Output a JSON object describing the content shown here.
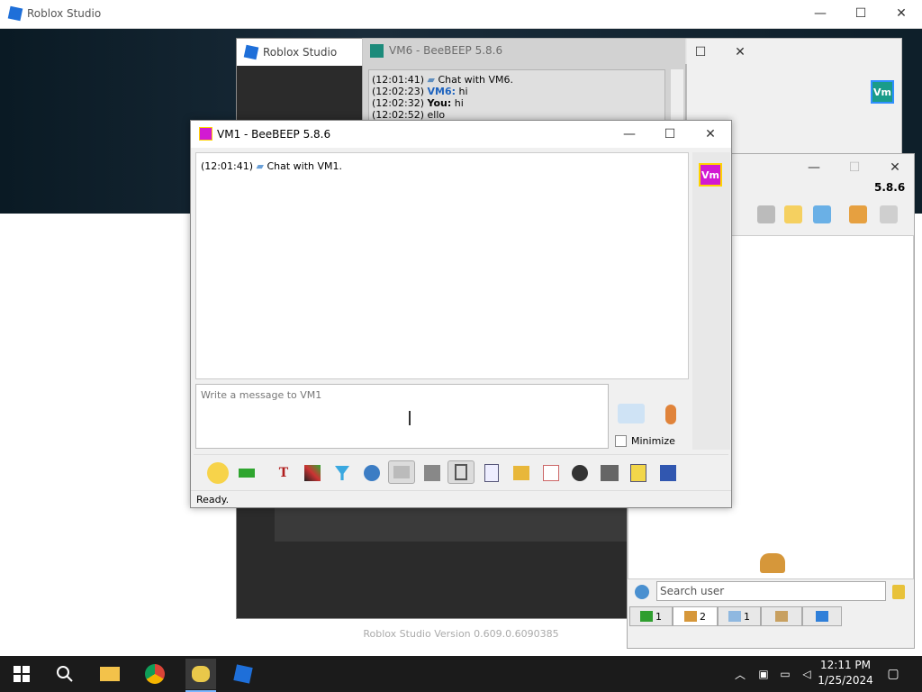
{
  "background_window": {
    "title": "Roblox Studio",
    "colors": {
      "banner": "#0e1f2a"
    }
  },
  "roblox_studio_2": {
    "title": "Roblox Studio",
    "version_text": "Roblox Studio Version 0.609.0.6090385"
  },
  "vm6_window": {
    "title": "VM6 - BeeBEEP 5.8.6",
    "messages": [
      {
        "time": "(12:01:41)",
        "sender": "",
        "text": "Chat with VM6."
      },
      {
        "time": "(12:02:23)",
        "sender": "VM6:",
        "text": "hi"
      },
      {
        "time": "(12:02:32)",
        "sender": "You:",
        "text": "hi"
      },
      {
        "time": "(12:02:52)",
        "sender": "",
        "text": "ello"
      }
    ],
    "badge_text": "Vm"
  },
  "contacts_window": {
    "version": "5.8.6",
    "search_placeholder": "Search user",
    "tabs": [
      {
        "icon": "computer-icon",
        "count": "1"
      },
      {
        "icon": "users-icon",
        "count": "2"
      },
      {
        "icon": "chat-icon",
        "count": "1"
      },
      {
        "icon": "group-icon",
        "count": ""
      },
      {
        "icon": "share-icon",
        "count": ""
      }
    ]
  },
  "vm1_window": {
    "title": "VM1 - BeeBEEP 5.8.6",
    "badge_text": "Vm",
    "messages": [
      {
        "time": "(12:01:41)",
        "text": "Chat with VM1."
      }
    ],
    "input_placeholder": "Write a message to VM1",
    "minimize_label": "Minimize",
    "status": "Ready.",
    "colors": {
      "badge_bg": "#d21ad2",
      "badge_border": "#ffd400"
    }
  },
  "taskbar": {
    "time": "12:11 PM",
    "date": "1/25/2024"
  }
}
